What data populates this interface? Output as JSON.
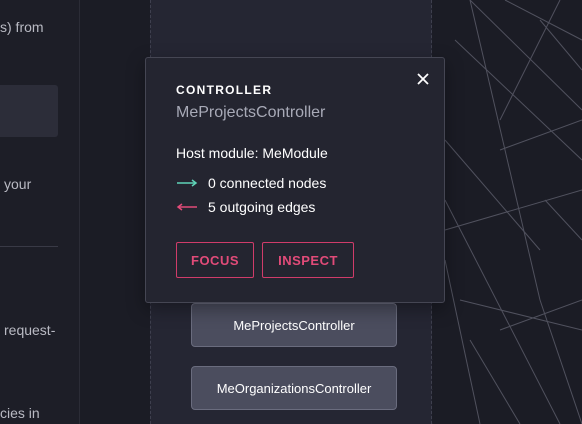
{
  "sidebar": {
    "lines": [
      "s) from",
      "your",
      "request-",
      "cies in"
    ]
  },
  "graph": {
    "nodes": [
      "MeProjectsController",
      "MeOrganizationsController"
    ]
  },
  "popup": {
    "kind": "CONTROLLER",
    "title": "MeProjectsController",
    "host_module": "Host module: MeModule",
    "stats": [
      {
        "icon": "arrow-right-icon",
        "color": "#5fd3b7",
        "text": "0 connected nodes"
      },
      {
        "icon": "arrow-left-icon",
        "color": "#e24b79",
        "text": "5 outgoing edges"
      }
    ],
    "buttons": {
      "focus": "FOCUS",
      "inspect": "INSPECT"
    }
  },
  "colors": {
    "accent": "#e24b79",
    "teal": "#5fd3b7",
    "background": "#1b1c25"
  }
}
